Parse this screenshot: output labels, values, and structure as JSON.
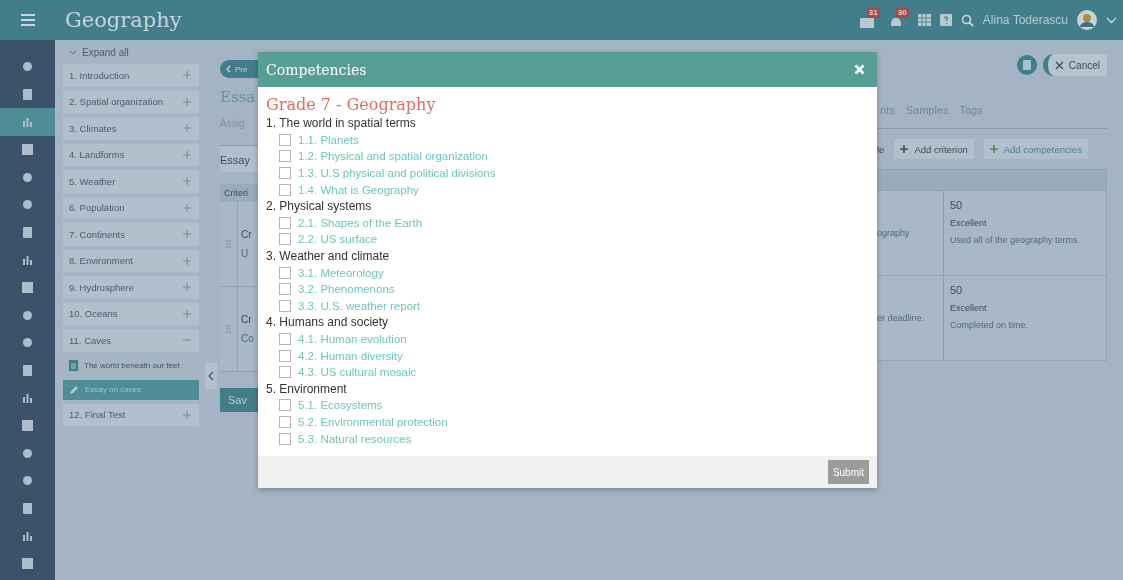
{
  "app_bar": {
    "title": "Geography",
    "badges": [
      "31",
      "30"
    ],
    "user": "Alina Toderascu"
  },
  "nav_rail": [
    {
      "selected": false
    },
    {
      "selected": false
    },
    {
      "selected": true
    },
    {
      "selected": false
    },
    {
      "selected": false
    },
    {
      "selected": false
    },
    {
      "selected": false
    },
    {
      "selected": false
    },
    {
      "selected": false
    },
    {
      "selected": false
    },
    {
      "selected": false
    },
    {
      "selected": false
    },
    {
      "selected": false
    },
    {
      "selected": false
    },
    {
      "selected": false
    },
    {
      "selected": false
    },
    {
      "selected": false
    },
    {
      "selected": false
    },
    {
      "selected": false
    }
  ],
  "outline": {
    "expand_all": "Expand all",
    "units": [
      {
        "label": "1. Introduction",
        "expanded": false
      },
      {
        "label": "2. Spatial organization",
        "expanded": false
      },
      {
        "label": "3. Climates",
        "expanded": false
      },
      {
        "label": "4. Landforms",
        "expanded": false
      },
      {
        "label": "5. Weather",
        "expanded": false
      },
      {
        "label": "6. Population",
        "expanded": false
      },
      {
        "label": "7. Continents",
        "expanded": false
      },
      {
        "label": "8. Environment",
        "expanded": false
      },
      {
        "label": "9. Hydrosphere",
        "expanded": false
      },
      {
        "label": "10. Oceans",
        "expanded": false
      },
      {
        "label": "11. Caves",
        "expanded": true,
        "children": [
          {
            "label": "The world beneath our feet",
            "kind": "document",
            "selected": false
          },
          {
            "label": "Essay on caves",
            "kind": "assignment",
            "selected": true
          }
        ]
      },
      {
        "label": "12. Final Test",
        "expanded": false
      }
    ]
  },
  "page_left": {
    "back": "Pre",
    "title": "Essa",
    "tab": "Assig",
    "dropdown": "Essay",
    "header": "Criteri",
    "rows": [
      {
        "name": "Cr",
        "note": "U"
      },
      {
        "name": "Cr",
        "note": "Co"
      }
    ],
    "save": "Sav"
  },
  "page_right": {
    "cancel": "Cancel",
    "tabs": [
      "nts",
      "Samples",
      "Tags"
    ],
    "toolbar": [
      {
        "label": "le",
        "kind": "text"
      },
      {
        "label": "Add criterion",
        "kind": "add"
      },
      {
        "label": "Add competencies",
        "kind": "add-green"
      }
    ],
    "rows": [
      {
        "column_1": "ography",
        "points": "50",
        "level": "Excellent",
        "description": "Used all of the geography terms."
      },
      {
        "column_1": "er deadline.",
        "points": "50",
        "level": "Excellent",
        "description": "Completed on time."
      }
    ]
  },
  "modal": {
    "title": "Competencies",
    "heading": "Grade 7 - Geography",
    "groups": [
      {
        "label": "1. The world in spatial terms",
        "children": [
          {
            "label": "1.1. Planets",
            "checked": false
          },
          {
            "label": "1.2. Physical and spatial organization",
            "checked": false
          },
          {
            "label": "1.3. U.S physical and political divisions",
            "checked": false
          },
          {
            "label": "1.4. What is Geography",
            "checked": false
          }
        ]
      },
      {
        "label": "2. Physical systems",
        "children": [
          {
            "label": "2.1. Shapes of the Earth",
            "checked": false
          },
          {
            "label": "2.2. US surface",
            "checked": false
          }
        ]
      },
      {
        "label": "3. Weather and climate",
        "children": [
          {
            "label": "3.1. Meteorology",
            "checked": false
          },
          {
            "label": "3.2. Phenomenons",
            "checked": false
          },
          {
            "label": "3.3. U.S. weather report",
            "checked": false
          }
        ]
      },
      {
        "label": "4. Humans and society",
        "children": [
          {
            "label": "4.1. Human evolution",
            "checked": false
          },
          {
            "label": "4.2. Human diversity",
            "checked": false
          },
          {
            "label": "4.3. US cultural mosaic",
            "checked": false
          }
        ]
      },
      {
        "label": "5. Environment",
        "children": [
          {
            "label": "5.1. Ecosystems",
            "checked": false
          },
          {
            "label": "5.2. Environmental protection",
            "checked": false
          },
          {
            "label": "5.3. Natural resources",
            "checked": false
          }
        ]
      }
    ],
    "submit": {
      "label": "Submit",
      "disabled": true
    }
  }
}
